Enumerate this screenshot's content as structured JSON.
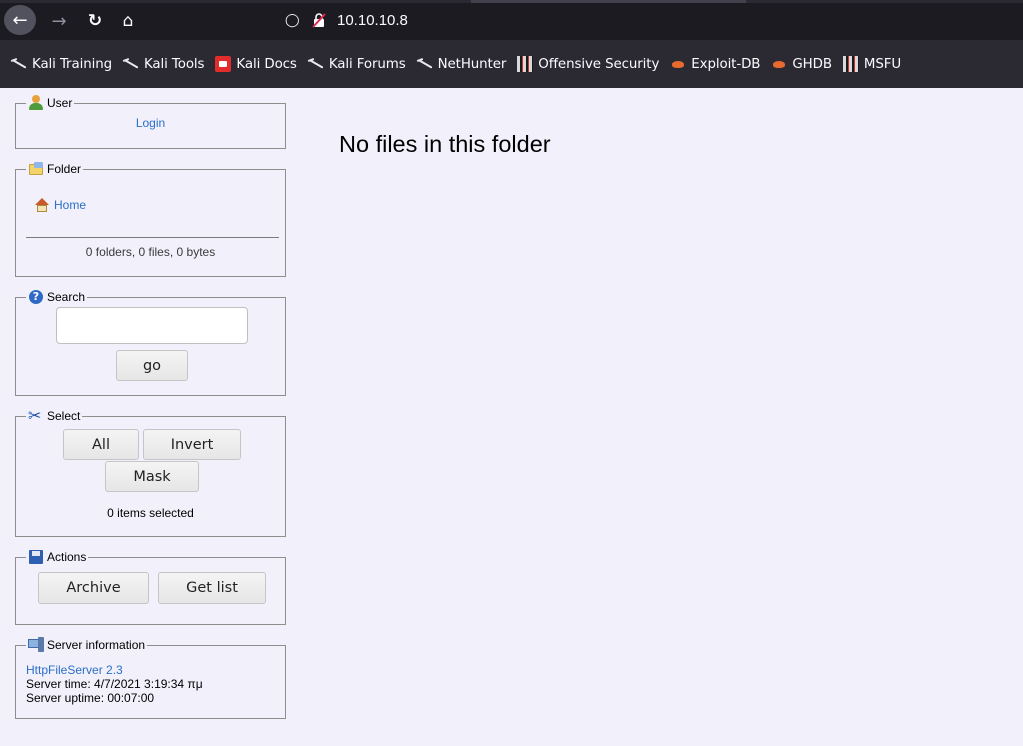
{
  "browser": {
    "url": "10.10.10.8",
    "bookmarks": [
      {
        "label": "Kali Training",
        "icon": "kali-dragon-icon"
      },
      {
        "label": "Kali Tools",
        "icon": "kali-dragon-icon"
      },
      {
        "label": "Kali Docs",
        "icon": "kali-docs-icon"
      },
      {
        "label": "Kali Forums",
        "icon": "kali-dragon-icon"
      },
      {
        "label": "NetHunter",
        "icon": "kali-dragon-icon"
      },
      {
        "label": "Offensive Security",
        "icon": "offsec-icon"
      },
      {
        "label": "Exploit-DB",
        "icon": "exploit-db-icon"
      },
      {
        "label": "GHDB",
        "icon": "exploit-db-icon"
      },
      {
        "label": "MSFU",
        "icon": "offsec-icon"
      }
    ]
  },
  "user": {
    "legend": "User",
    "login_link": "Login"
  },
  "folder": {
    "legend": "Folder",
    "home_link": "Home",
    "summary": "0 folders, 0 files, 0 bytes"
  },
  "search": {
    "legend": "Search",
    "value": "",
    "go_label": "go"
  },
  "select": {
    "legend": "Select",
    "all_label": "All",
    "invert_label": "Invert",
    "mask_label": "Mask",
    "status": "0 items selected"
  },
  "actions": {
    "legend": "Actions",
    "archive_label": "Archive",
    "getlist_label": "Get list"
  },
  "server_info": {
    "legend": "Server information",
    "software_link": "HttpFileServer 2.3",
    "server_time": "Server time: 4/7/2021 3:19:34 πμ",
    "server_uptime": "Server uptime: 00:07:00"
  },
  "main": {
    "message": "No files in this folder"
  }
}
